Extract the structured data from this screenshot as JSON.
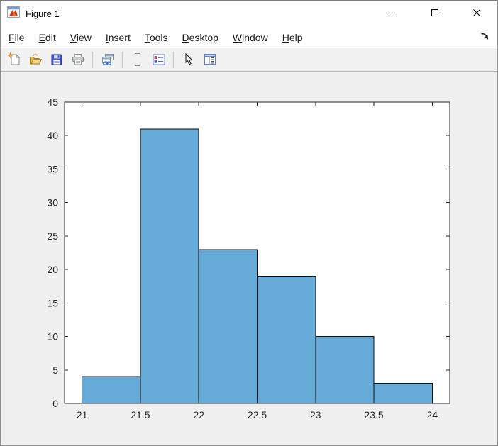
{
  "window": {
    "title": "Figure 1",
    "app_icon": "matlab-logo-icon",
    "controls": [
      {
        "name": "minimize",
        "icon": "minimize-icon"
      },
      {
        "name": "maximize",
        "icon": "maximize-icon"
      },
      {
        "name": "close",
        "icon": "close-icon"
      }
    ]
  },
  "menu": {
    "items": [
      {
        "label": "File"
      },
      {
        "label": "Edit"
      },
      {
        "label": "View"
      },
      {
        "label": "Insert"
      },
      {
        "label": "Tools"
      },
      {
        "label": "Desktop"
      },
      {
        "label": "Window"
      },
      {
        "label": "Help"
      }
    ],
    "dock_icon": "dock-figure-icon"
  },
  "toolbar": {
    "items": [
      {
        "name": "new-figure",
        "icon": "new-figure-icon"
      },
      {
        "name": "open-file",
        "icon": "open-folder-icon"
      },
      {
        "name": "save-figure",
        "icon": "save-icon"
      },
      {
        "name": "print-figure",
        "icon": "print-icon"
      },
      {
        "sep": true
      },
      {
        "name": "link-plot",
        "icon": "link-plot-icon"
      },
      {
        "sep": true
      },
      {
        "name": "insert-colorbar",
        "icon": "colorbar-icon"
      },
      {
        "name": "insert-legend",
        "icon": "legend-icon"
      },
      {
        "sep": true
      },
      {
        "name": "edit-plot",
        "icon": "edit-plot-arrow-icon"
      },
      {
        "name": "property-inspector",
        "icon": "property-inspector-icon"
      }
    ]
  },
  "chart_data": {
    "type": "histogram",
    "title": "",
    "xlabel": "",
    "ylabel": "",
    "bin_edges": [
      21,
      21.5,
      22,
      22.5,
      23,
      23.5,
      24
    ],
    "counts": [
      4,
      41,
      23,
      19,
      10,
      3
    ],
    "xlim": [
      20.85,
      24.15
    ],
    "ylim": [
      0,
      45
    ],
    "xticks": [
      21,
      21.5,
      22,
      22.5,
      23,
      23.5,
      24
    ],
    "xtick_labels": [
      "21",
      "21.5",
      "22",
      "22.5",
      "23",
      "23.5",
      "24"
    ],
    "yticks": [
      0,
      5,
      10,
      15,
      20,
      25,
      30,
      35,
      40,
      45
    ],
    "ytick_labels": [
      "0",
      "5",
      "10",
      "15",
      "20",
      "25",
      "30",
      "35",
      "40",
      "45"
    ],
    "grid": false,
    "legend": null,
    "colors": {
      "bar_fill": "#66aad7",
      "bar_edge": "#0f0f0f",
      "axis": "#262626",
      "plot_background": "#ffffff",
      "figure_background": "#f0f0f0"
    }
  }
}
